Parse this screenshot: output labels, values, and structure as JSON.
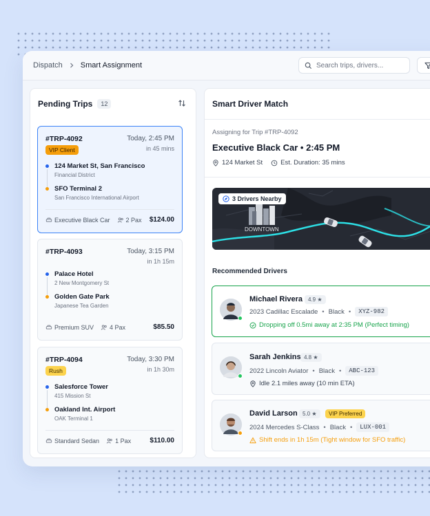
{
  "breadcrumb": {
    "root": "Dispatch",
    "current": "Smart Assignment"
  },
  "search": {
    "placeholder": "Search trips, drivers..."
  },
  "pending": {
    "title": "Pending Trips",
    "count": "12",
    "trips": [
      {
        "id": "#TRP-4092",
        "time": "Today, 2:45 PM",
        "eta": "in 45 mins",
        "tag": "VIP Client",
        "pickup": "124 Market St, San Francisco",
        "pickup_sub": "Financial District",
        "dropoff": "SFO Terminal 2",
        "dropoff_sub": "San Francisco International Airport",
        "vehicle": "Executive Black Car",
        "pax": "2 Pax",
        "price": "$124.00"
      },
      {
        "id": "#TRP-4093",
        "time": "Today, 3:15 PM",
        "eta": "in 1h 15m",
        "tag": "",
        "pickup": "Palace Hotel",
        "pickup_sub": "2 New Montgomery St",
        "dropoff": "Golden Gate Park",
        "dropoff_sub": "Japanese Tea Garden",
        "vehicle": "Premium SUV",
        "pax": "4 Pax",
        "price": "$85.50"
      },
      {
        "id": "#TRP-4094",
        "time": "Today, 3:30 PM",
        "eta": "in 1h 30m",
        "tag": "Rush",
        "pickup": "Salesforce Tower",
        "pickup_sub": "415 Mission St",
        "dropoff": "Oakland Int. Airport",
        "dropoff_sub": "OAK Terminal 1",
        "vehicle": "Standard Sedan",
        "pax": "1 Pax",
        "price": "$110.00"
      }
    ]
  },
  "match": {
    "title": "Smart Driver Match",
    "assigning": "Assigning for Trip #TRP-4092",
    "trip_title": "Executive Black Car • 2:45 PM",
    "location": "124 Market St",
    "duration": "Est. Duration: 35 mins",
    "map_badge": "3 Drivers Nearby",
    "map_label": "DOWNTOWN",
    "recommended_title": "Recommended Drivers",
    "drivers": [
      {
        "name": "Michael Rivera",
        "rating": "4.9 ★",
        "badge": "",
        "vehicle": "2023 Cadillac Escalade",
        "color": "Black",
        "plate": "XYZ-982",
        "status": "Dropping off 0.5mi away at 2:35 PM (Perfect timing)",
        "status_color": "#16a34a"
      },
      {
        "name": "Sarah Jenkins",
        "rating": "4.8 ★",
        "badge": "",
        "vehicle": "2022 Lincoln Aviator",
        "color": "Black",
        "plate": "ABC-123",
        "status": "Idle 2.1 miles away (10 min ETA)",
        "status_color": "#374151"
      },
      {
        "name": "David Larson",
        "rating": "5.0 ★",
        "badge": "VIP Preferred",
        "vehicle": "2024 Mercedes S-Class",
        "color": "Black",
        "plate": "LUX-001",
        "status": "Shift ends in 1h 15m (Tight window for SFO traffic)",
        "status_color": "#f59e0b"
      }
    ]
  },
  "colors": {
    "accent": "#3b82f6",
    "success": "#16a34a",
    "warning": "#f59e0b",
    "route": "#2de0e6"
  }
}
